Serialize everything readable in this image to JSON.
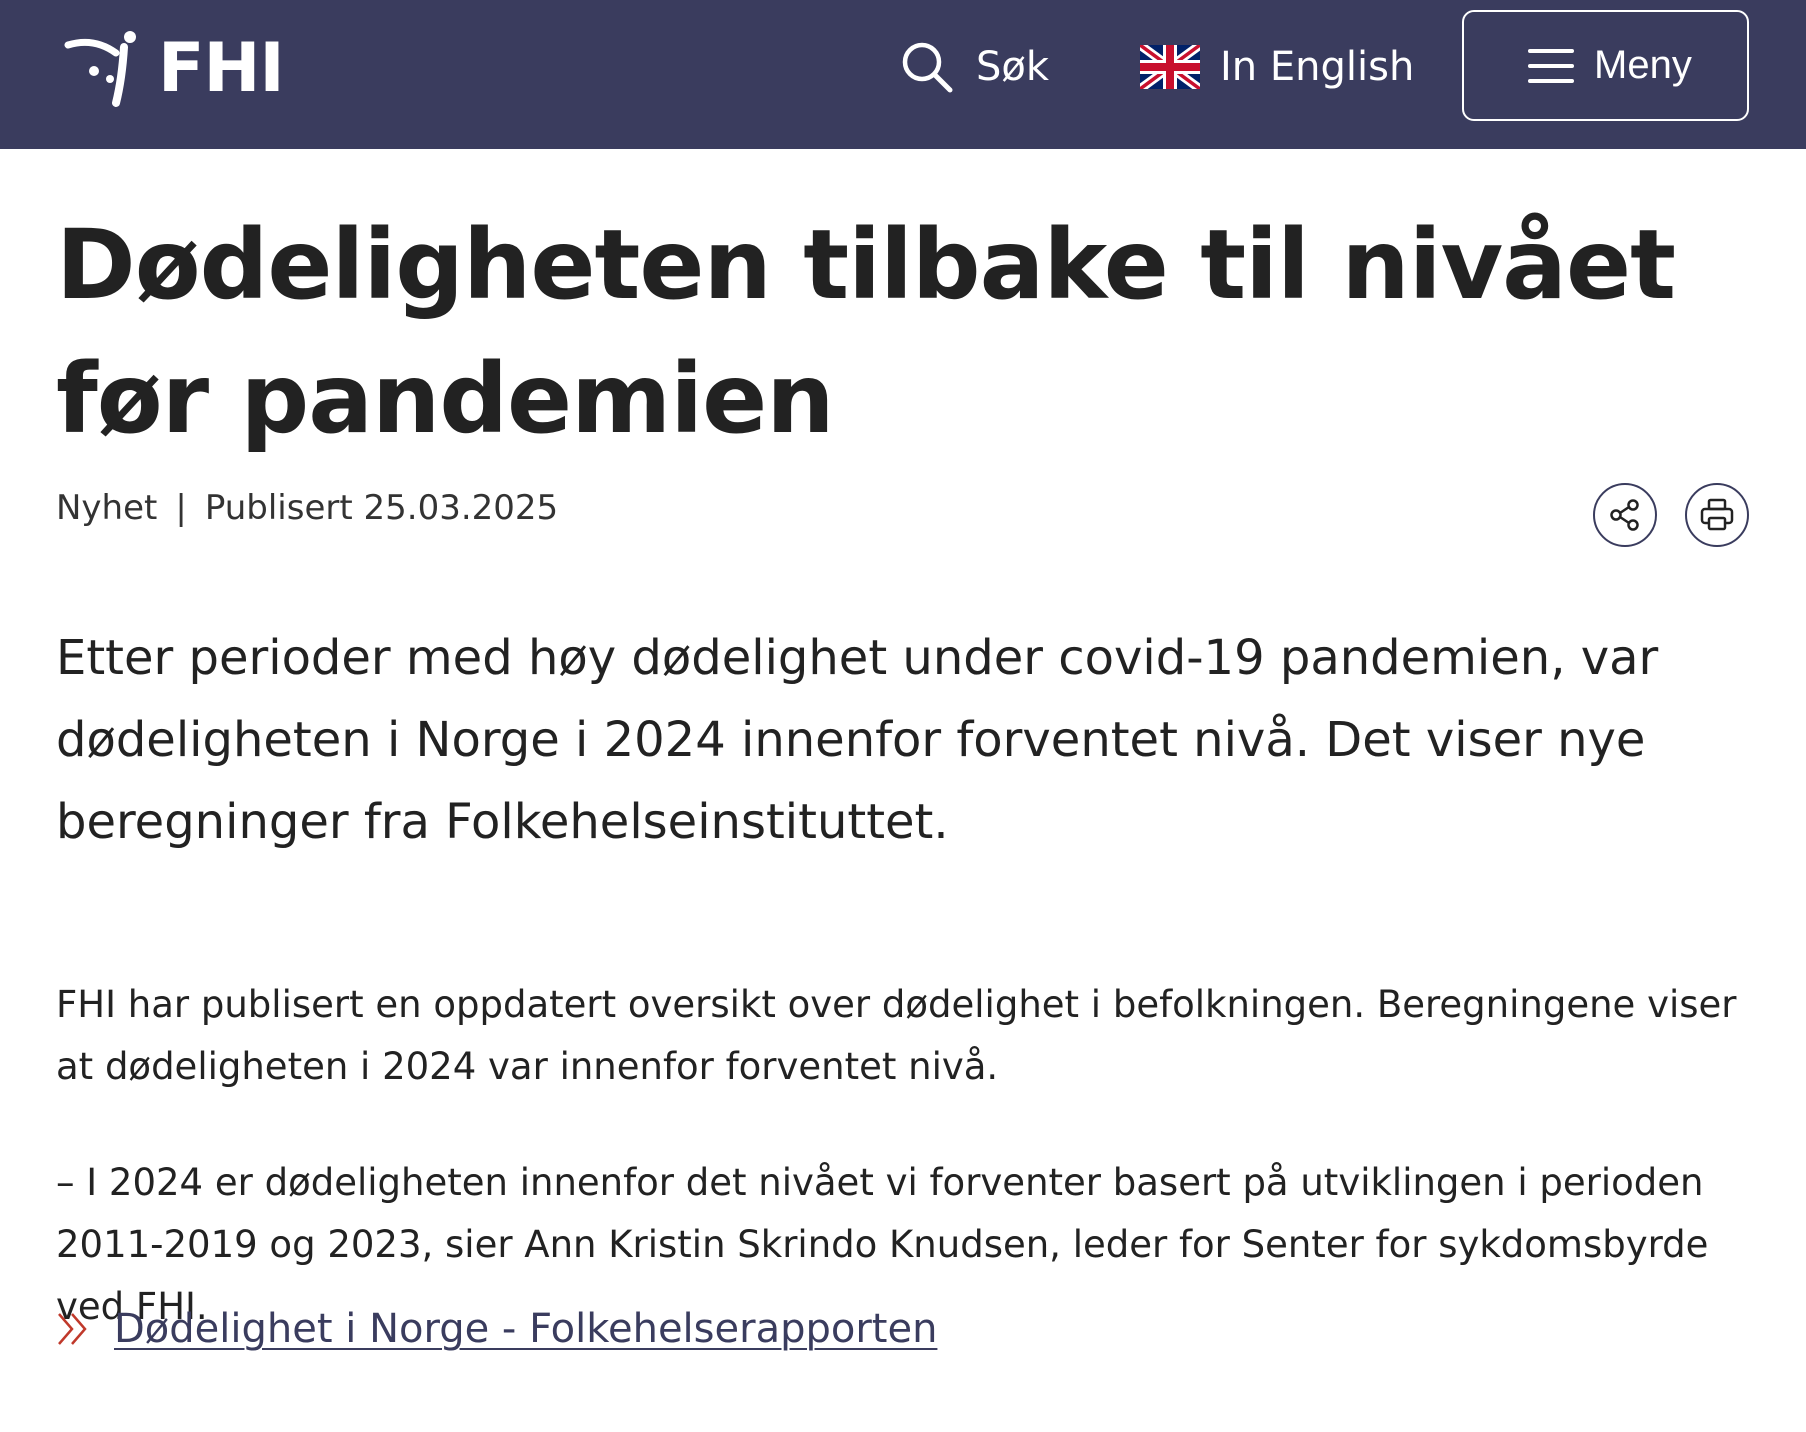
{
  "header": {
    "logo_text": "FHI",
    "search_label": "Søk",
    "english_label": "In English",
    "menu_label": "Meny",
    "colors": {
      "background": "#3a3c5e",
      "text": "#ffffff"
    }
  },
  "article": {
    "title": "Dødeligheten tilbake til nivået før pandemien",
    "category": "Nyhet",
    "separator": "|",
    "published": "Publisert 25.03.2025",
    "lead": "Etter perioder med høy dødelighet under covid-19 pandemien, var dødeligheten i Norge i 2024 innenfor forventet nivå. Det viser nye beregninger fra Folkehelseinstituttet.",
    "paragraphs": [
      "FHI har publisert en oppdatert oversikt over dødelighet i befolkningen. Beregningene viser at dødeligheten i 2024 var innenfor forventet nivå.",
      "– I 2024 er dødeligheten innenfor det nivået vi forventer basert på utviklingen i perioden 2011-2019 og 2023, sier Ann Kristin Skrindo Knudsen, leder for Senter for sykdomsbyrde ved FHI."
    ],
    "related_link": "Dødelighet i Norge - Folkehelserapporten"
  },
  "icons": {
    "search": "search-icon",
    "flag": "uk-flag-icon",
    "menu": "hamburger-icon",
    "share": "share-icon",
    "print": "print-icon",
    "link_arrow": "double-chevron-right-icon"
  },
  "accent_colors": {
    "link": "#3a3c5e",
    "chevron": "#c0392b"
  }
}
